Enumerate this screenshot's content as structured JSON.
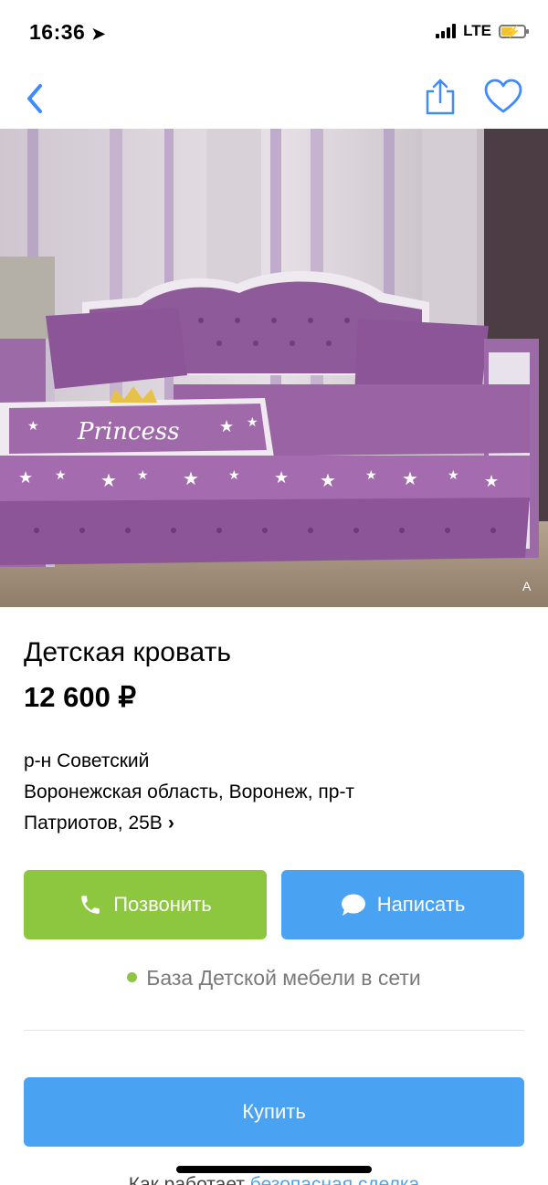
{
  "status_bar": {
    "time": "16:36",
    "network": "LTE"
  },
  "nav": {
    "back_icon": "chevron-left-icon",
    "share_icon": "share-icon",
    "favorite_icon": "heart-icon"
  },
  "photo": {
    "watermark": "A"
  },
  "listing": {
    "title": "Детская кровать",
    "price": "12 600 ₽",
    "district": "р-н Советский",
    "address_line1": "Воронежская область, Воронеж, пр-т",
    "address_line2": "Патриотов, 25В",
    "address_chevron": "›"
  },
  "actions": {
    "call_label": "Позвонить",
    "message_label": "Написать",
    "buy_label": "Купить"
  },
  "seller": {
    "status": "База Детской мебели в сети"
  },
  "cutoff_text": {
    "prefix": "Как работает ",
    "link": "безопасная сделка"
  },
  "colors": {
    "green": "#8dc63f",
    "blue": "#4aa3f2",
    "accent": "#3d8bfd"
  }
}
